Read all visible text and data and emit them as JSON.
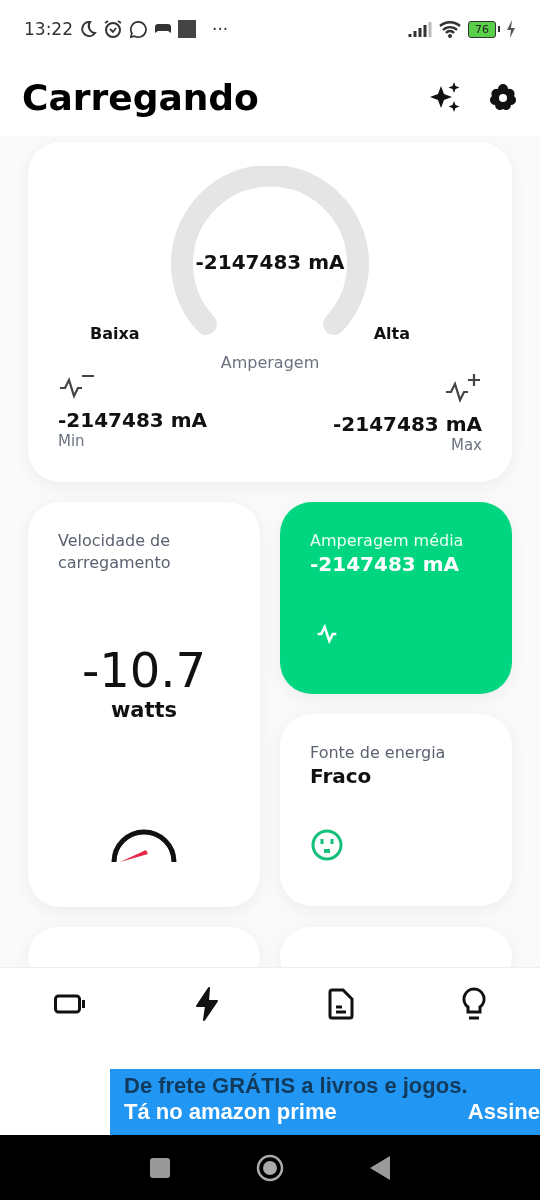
{
  "status_bar": {
    "time": "13:22",
    "more": "···",
    "battery": "76"
  },
  "header": {
    "title": "Carregando"
  },
  "amperage_card": {
    "value": "-2147483 mA",
    "low_label": "Baixa",
    "high_label": "Alta",
    "caption": "Amperagem",
    "min": {
      "value": "-2147483 mA",
      "label": "Min"
    },
    "max": {
      "value": "-2147483 mA",
      "label": "Max"
    }
  },
  "speed_card": {
    "title": "Velocidade de carregamento",
    "value": "-10.7",
    "unit": "watts"
  },
  "average_card": {
    "title": "Amperagem média",
    "value": "-2147483 mA"
  },
  "source_card": {
    "title": "Fonte de energia",
    "value": "Fraco"
  },
  "bottom_nav": [
    {
      "kind": "battery",
      "selected": false
    },
    {
      "kind": "charge",
      "selected": true
    },
    {
      "kind": "document",
      "selected": false
    },
    {
      "kind": "tips",
      "selected": false
    }
  ],
  "ad": {
    "headline": "De frete GRÁTIS a livros e jogos.",
    "subline": "Tá no amazon prime",
    "action": "Assine"
  }
}
